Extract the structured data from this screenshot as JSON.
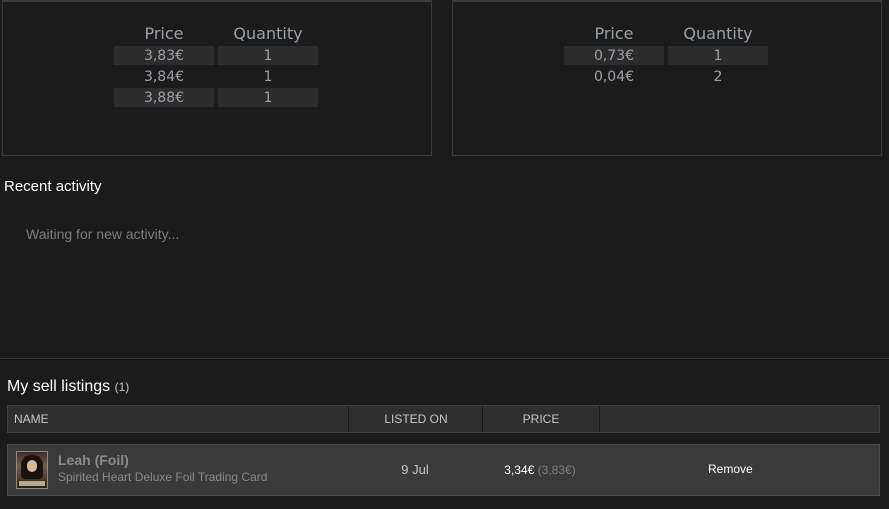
{
  "buy_orders_left": {
    "headers": {
      "price": "Price",
      "quantity": "Quantity"
    },
    "rows": [
      {
        "price": "3,83€",
        "quantity": "1"
      },
      {
        "price": "3,84€",
        "quantity": "1"
      },
      {
        "price": "3,88€",
        "quantity": "1"
      }
    ]
  },
  "buy_orders_right": {
    "headers": {
      "price": "Price",
      "quantity": "Quantity"
    },
    "rows": [
      {
        "price": "0,73€",
        "quantity": "1"
      },
      {
        "price": "0,04€",
        "quantity": "2"
      }
    ]
  },
  "recent_activity": {
    "title": "Recent activity",
    "waiting": "Waiting for new activity..."
  },
  "sell_listings": {
    "title": "My sell listings",
    "count": "(1)",
    "columns": {
      "name": "NAME",
      "listed_on": "LISTED ON",
      "price": "PRICE"
    },
    "items": [
      {
        "name": "Leah (Foil)",
        "game": "Spirited Heart Deluxe Foil Trading Card",
        "listed_on": "9 Jul",
        "price": "3,34€",
        "price_with_fee": "(3,83€)",
        "remove_label": "Remove"
      }
    ]
  }
}
